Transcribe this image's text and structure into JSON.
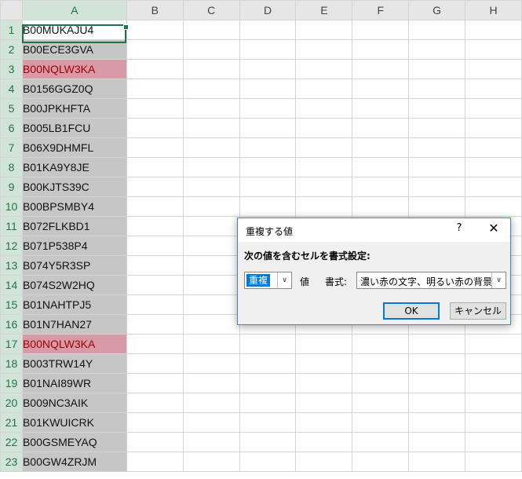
{
  "spreadsheet": {
    "columns": [
      "A",
      "B",
      "C",
      "D",
      "E",
      "F",
      "G",
      "H"
    ],
    "rows": [
      {
        "num": "1",
        "a": "B00MUKAJU4",
        "dup": false
      },
      {
        "num": "2",
        "a": "B00ECE3GVA",
        "dup": false
      },
      {
        "num": "3",
        "a": "B00NQLW3KA",
        "dup": true
      },
      {
        "num": "4",
        "a": "B0156GGZ0Q",
        "dup": false
      },
      {
        "num": "5",
        "a": "B00JPKHFTA",
        "dup": false
      },
      {
        "num": "6",
        "a": "B005LB1FCU",
        "dup": false
      },
      {
        "num": "7",
        "a": "B06X9DHMFL",
        "dup": false
      },
      {
        "num": "8",
        "a": "B01KA9Y8JE",
        "dup": false
      },
      {
        "num": "9",
        "a": "B00KJTS39C",
        "dup": false
      },
      {
        "num": "10",
        "a": "B00BPSMBY4",
        "dup": false
      },
      {
        "num": "11",
        "a": "B072FLKBD1",
        "dup": false
      },
      {
        "num": "12",
        "a": "B071P538P4",
        "dup": false
      },
      {
        "num": "13",
        "a": "B074Y5R3SP",
        "dup": false
      },
      {
        "num": "14",
        "a": "B074S2W2HQ",
        "dup": false
      },
      {
        "num": "15",
        "a": "B01NAHTPJ5",
        "dup": false
      },
      {
        "num": "16",
        "a": "B01N7HAN27",
        "dup": false
      },
      {
        "num": "17",
        "a": "B00NQLW3KA",
        "dup": true
      },
      {
        "num": "18",
        "a": "B003TRW14Y",
        "dup": false
      },
      {
        "num": "19",
        "a": "B01NAI89WR",
        "dup": false
      },
      {
        "num": "20",
        "a": "B009NC3AIK",
        "dup": false
      },
      {
        "num": "21",
        "a": "B01KWUICRK",
        "dup": false
      },
      {
        "num": "22",
        "a": "B00GSMEYAQ",
        "dup": false
      },
      {
        "num": "23",
        "a": "B00GW4ZRJM",
        "dup": false
      }
    ],
    "colors": {
      "selection_fill": "#c6c6c6",
      "duplicate_fill": "#d89aa4",
      "duplicate_text": "#9c0006",
      "accent_green": "#217346"
    }
  },
  "dialog": {
    "title": "重複する値",
    "help": "?",
    "close": "✕",
    "prompt": "次の値を含むセルを書式設定:",
    "mode_value": "重複",
    "value_label": "値",
    "format_label": "書式:",
    "format_value": "濃い赤の文字、明るい赤の背景",
    "ok_label": "OK",
    "cancel_label": "キャンセル",
    "dropdown_glyph": "∨",
    "colors": {
      "accent": "#0078d7"
    }
  }
}
